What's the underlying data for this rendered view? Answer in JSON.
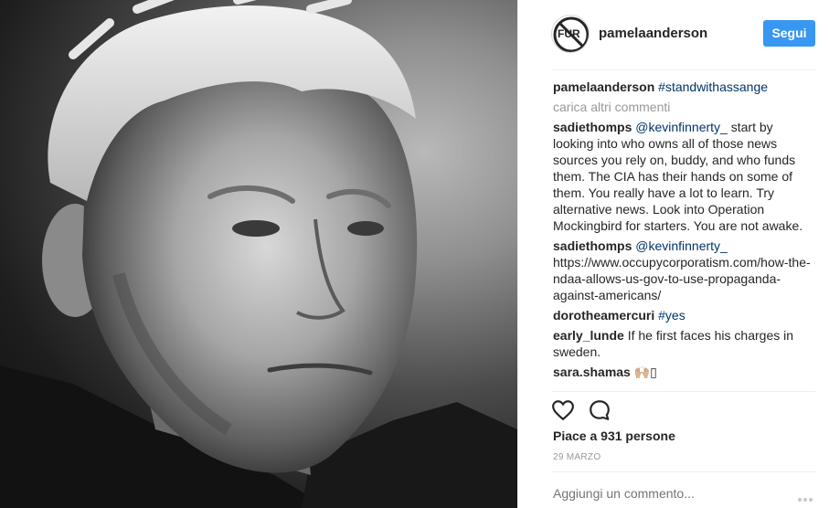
{
  "post": {
    "image_icon": "portrait-photo",
    "author": "pamelaanderson",
    "avatar_text": "FUR",
    "follow_label": "Segui"
  },
  "caption": {
    "user": "pamelaanderson",
    "tag": "#standwithassange"
  },
  "load_more": "carica altri commenti",
  "comments": [
    {
      "user": "sadiethomps",
      "mention": "@kevinfinnerty_",
      "text": " start by looking into who owns all of those news sources you rely on, buddy, and who funds them. The CIA has their hands on some of them. You really have a lot to learn. Try alternative news. Look into Operation Mockingbird for starters. You are not awake."
    },
    {
      "user": "sadiethomps",
      "mention": "@kevinfinnerty_",
      "text": " https://www.occupycorporatism.com/how-the-ndaa-allows-us-gov-to-use-propaganda-against-americans/"
    },
    {
      "user": "dorotheamercuri",
      "mention": "#yes",
      "text": ""
    },
    {
      "user": "early_lunde",
      "mention": "",
      "text": " If he first faces his charges in sweden."
    },
    {
      "user": "sara.shamas",
      "mention": "",
      "text": " 🙌🏼▯"
    }
  ],
  "actions": {
    "like_icon": "heart-icon",
    "comment_icon": "comment-icon"
  },
  "likes": "Piace a 931 persone",
  "date": "29 MARZO",
  "comment_input": {
    "placeholder": "Aggiungi un commento..."
  },
  "colors": {
    "follow_button": "#3897f0",
    "link": "#003569",
    "muted": "#999999",
    "divider": "#efefef"
  }
}
